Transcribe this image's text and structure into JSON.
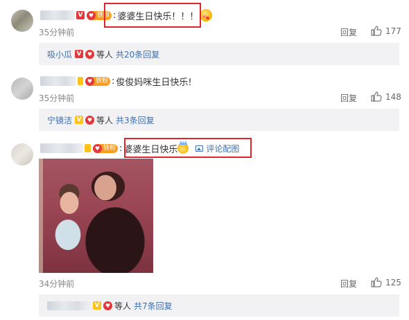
{
  "comments": [
    {
      "text": "婆婆生日快乐！！！",
      "time": "35分钟前",
      "reply_label": "回复",
      "likes": "177",
      "fan_badge": "铁粉",
      "emoji": "heart-eyes-emoji",
      "sub": {
        "name": "吸小瓜",
        "suffix": "等人",
        "count": "共20条回复"
      }
    },
    {
      "text": "俊俊妈咪生日快乐!",
      "time": "35分钟前",
      "reply_label": "回复",
      "likes": "148",
      "fan_badge": "铁粉",
      "sub": {
        "name": "宁镜洁",
        "suffix": "等人",
        "count": "共3条回复"
      }
    },
    {
      "text": "婆婆生日快乐",
      "image_link": "评论配图",
      "time": "34分钟前",
      "reply_label": "回复",
      "likes": "125",
      "fan_badge": "铁粉",
      "emoji": "crown-emoji",
      "sub": {
        "name": "",
        "suffix": "等人",
        "count": "共7条回复"
      }
    }
  ],
  "colors": {
    "link": "#3b6fb0",
    "highlight": "#e0242b",
    "fan_badge": "#f59d24",
    "sub_bg": "#f2f2f5"
  }
}
